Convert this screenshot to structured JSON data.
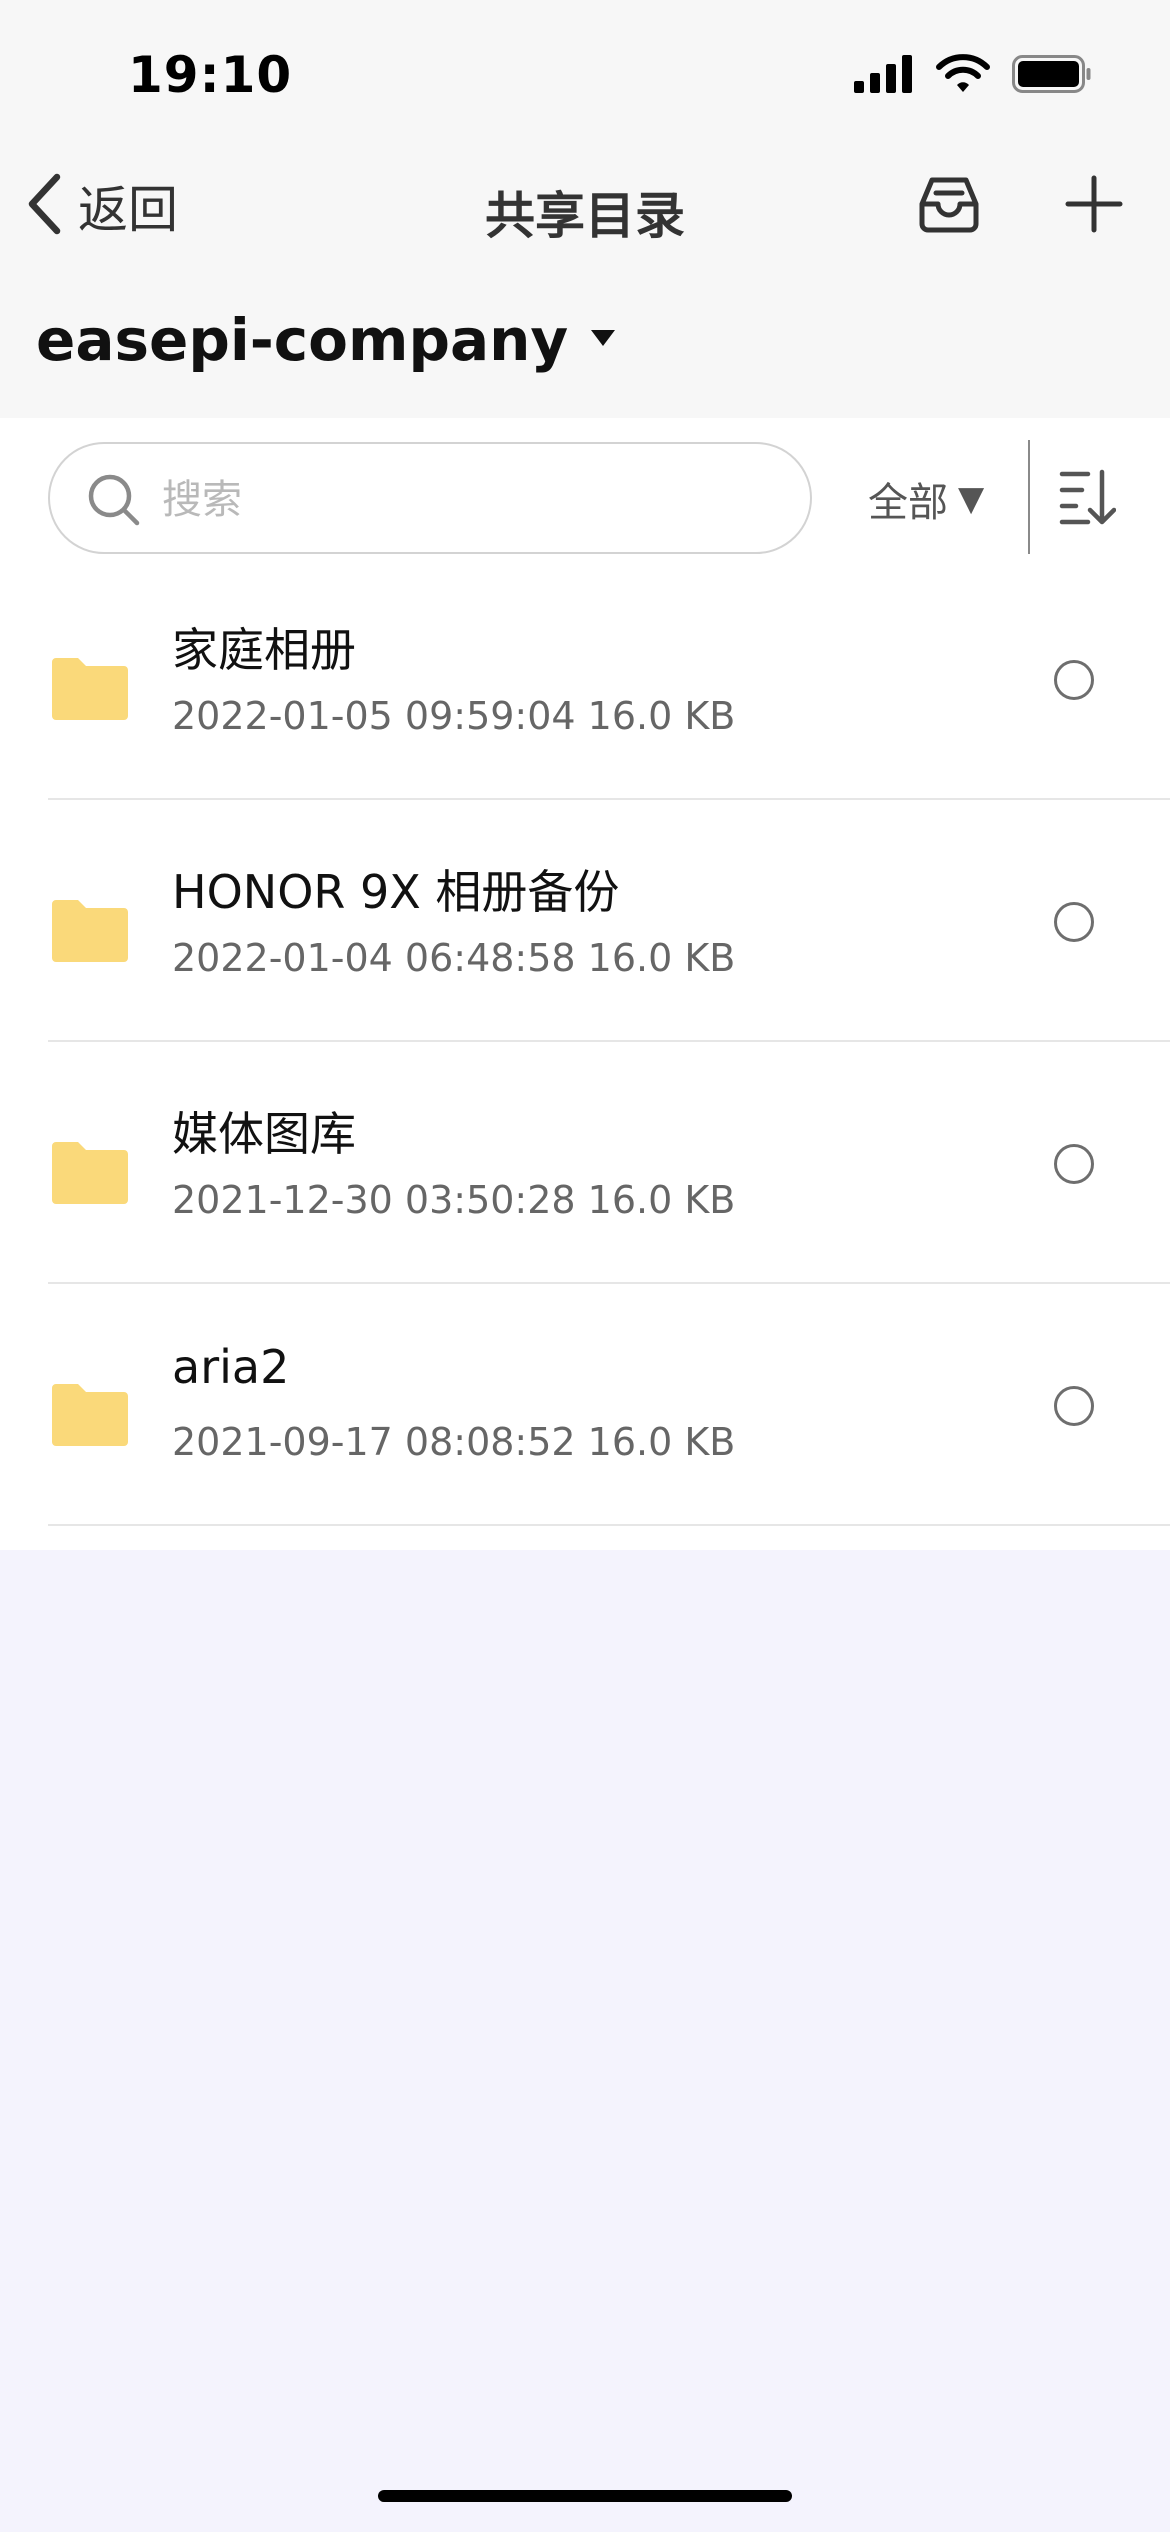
{
  "status_bar": {
    "time": "19:10"
  },
  "nav": {
    "back_label": "返回",
    "title": "共享目录"
  },
  "server": {
    "name": "easepi-company"
  },
  "toolbar": {
    "search_placeholder": "搜索",
    "search_value": "",
    "filter_label": "全部",
    "filter_arrow": "▼"
  },
  "files": [
    {
      "name": "家庭相册",
      "meta": "2022-01-05 09:59:04 16.0 KB"
    },
    {
      "name": "HONOR 9X 相册备份",
      "meta": "2022-01-04 06:48:58 16.0 KB"
    },
    {
      "name": "媒体图库",
      "meta": "2021-12-30 03:50:28 16.0 KB"
    },
    {
      "name": "aria2",
      "meta": "2021-09-17 08:08:52 16.0 KB"
    }
  ],
  "colors": {
    "folder": "#fad97a",
    "header_bg": "#f7f7f7",
    "page_bg": "#f4f3fd"
  },
  "icons": {
    "back": "chevron-left-icon",
    "inbox": "inbox-icon",
    "add": "plus-icon",
    "dropdown": "caret-down-icon",
    "search": "search-icon",
    "sort": "sort-descending-icon",
    "folder": "folder-icon",
    "radio": "radio-unchecked-icon"
  }
}
